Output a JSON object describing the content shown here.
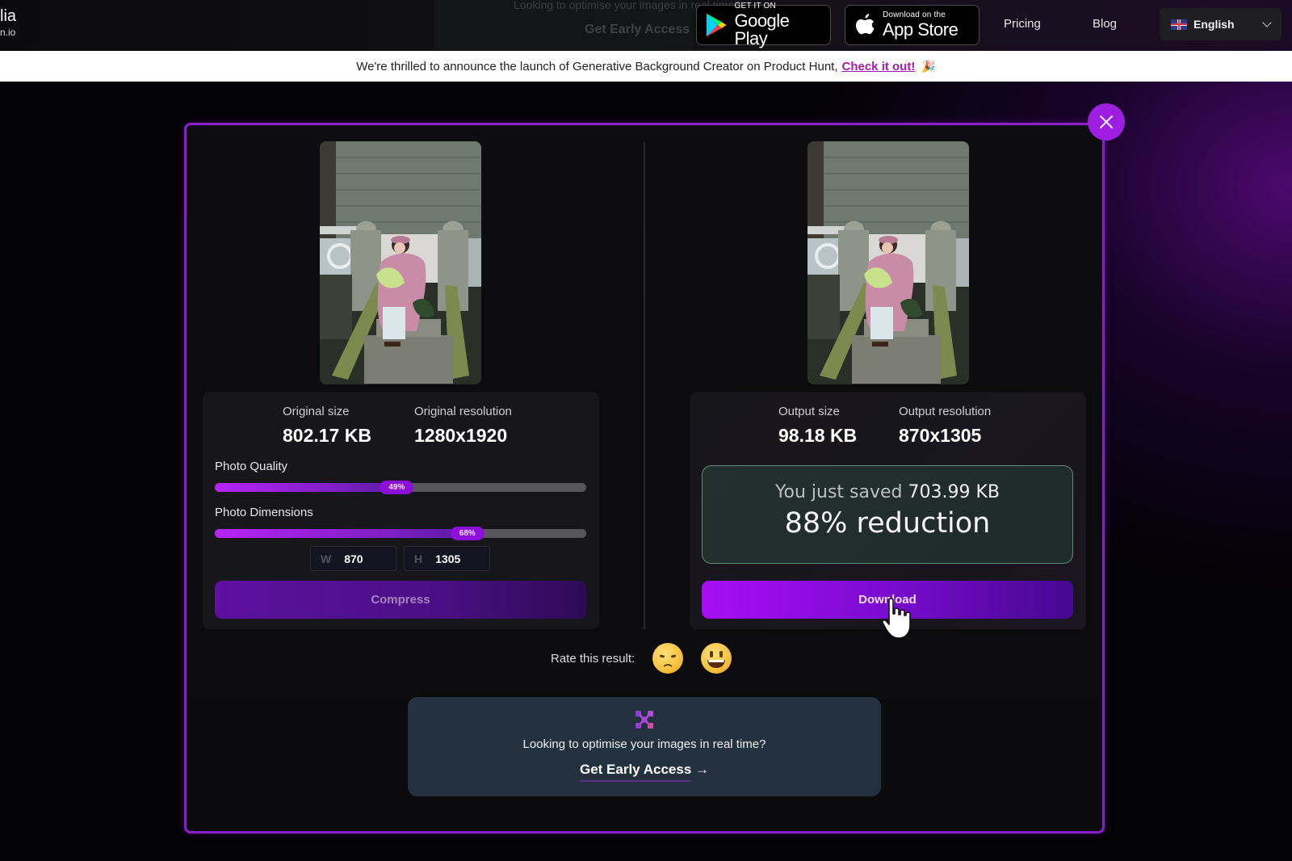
{
  "brand": {
    "name": "lia",
    "domain": "n.io"
  },
  "ghost_promo": {
    "text": "Looking to optimise your images in real time?",
    "cta": "Get Early Access"
  },
  "nav": {
    "google_play": {
      "small": "GET IT ON",
      "big": "Google Play",
      "icon": "google-play-icon"
    },
    "app_store": {
      "small": "Download on the",
      "big": "App Store",
      "icon": "apple-icon"
    },
    "links": [
      "Pricing",
      "Blog"
    ],
    "language": {
      "selected": "English",
      "icon": "uk-flag-icon"
    }
  },
  "announcement": {
    "text": "We're thrilled to announce the launch of Generative Background Creator on Product Hunt,",
    "link": "Check it out!",
    "emoji": "🎉"
  },
  "colors": {
    "accent": "#9d1ee0",
    "modal_border": "#8b1fd0",
    "saved_border": "#5e8b7a",
    "promo_bg": "#243240"
  },
  "original": {
    "size_label": "Original size",
    "size_value": "802.17 KB",
    "resolution_label": "Original resolution",
    "resolution_value": "1280x1920",
    "quality": {
      "label": "Photo Quality",
      "value": 49,
      "display": "49%"
    },
    "dimensions": {
      "label": "Photo Dimensions",
      "value": 68,
      "display": "68%"
    },
    "width": {
      "prefix": "W",
      "value": "870"
    },
    "height": {
      "prefix": "H",
      "value": "1305"
    },
    "compress_label": "Compress"
  },
  "output": {
    "size_label": "Output size",
    "size_value": "98.18 KB",
    "resolution_label": "Output resolution",
    "resolution_value": "870x1305",
    "saved_prefix": "You just saved",
    "saved_amount": "703.99 KB",
    "reduction": "88% reduction",
    "download_label": "Download"
  },
  "rating": {
    "label": "Rate this result:",
    "options": [
      "pensive-face",
      "grinning-face"
    ]
  },
  "promo": {
    "text": "Looking to optimise your images in real time?",
    "cta": "Get Early Access",
    "arrow": "→"
  }
}
